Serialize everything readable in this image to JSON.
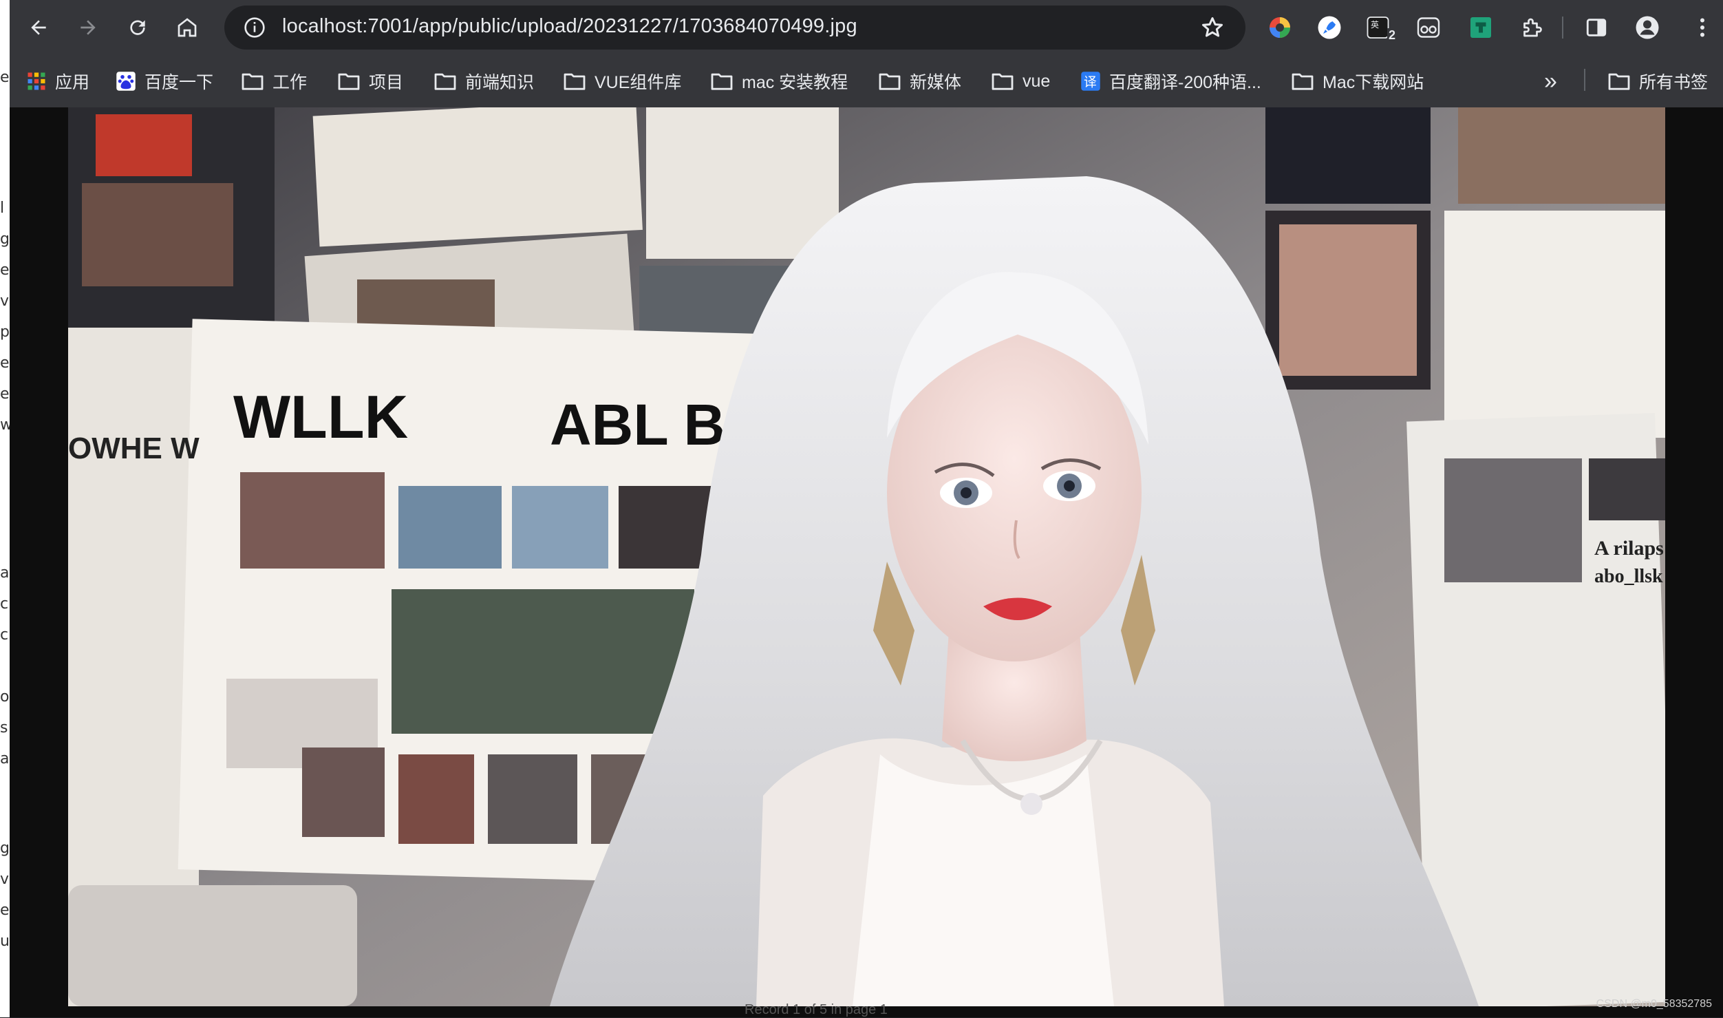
{
  "browser": {
    "url": "localhost:7001/app/public/upload/20231227/1703684070499.jpg",
    "extension_badge": "2"
  },
  "bookmarks": [
    {
      "label": "应用",
      "icon": "apps-grid-icon"
    },
    {
      "label": "百度一下",
      "icon": "baidu-paw-icon"
    },
    {
      "label": "工作",
      "icon": "folder-icon"
    },
    {
      "label": "项目",
      "icon": "folder-icon"
    },
    {
      "label": "前端知识",
      "icon": "folder-icon"
    },
    {
      "label": "VUE组件库",
      "icon": "folder-icon"
    },
    {
      "label": "mac 安装教程",
      "icon": "folder-icon"
    },
    {
      "label": "新媒体",
      "icon": "folder-icon"
    },
    {
      "label": "vue",
      "icon": "folder-icon"
    },
    {
      "label": "百度翻译-200种语...",
      "icon": "translate-icon"
    },
    {
      "label": "Mac下载网站",
      "icon": "folder-icon"
    }
  ],
  "bookmarks_overflow": "»",
  "all_bookmarks": "所有书签",
  "image": {
    "headline_left": "WLLK",
    "headline_right": "ABL BFIAEI",
    "side_headline": "OWHE W",
    "right_paper_text": "A rilaps a",
    "right_paper_text2": "abo_llsk"
  },
  "footer": {
    "record_text": "Record 1 of 5 in page 1",
    "watermark": "CSDN @m0_58352785"
  },
  "colors": {
    "toolbar": "#35363a",
    "omnibox": "#202124",
    "text": "#e8eaed",
    "translate_blue": "#2b7bf3"
  }
}
